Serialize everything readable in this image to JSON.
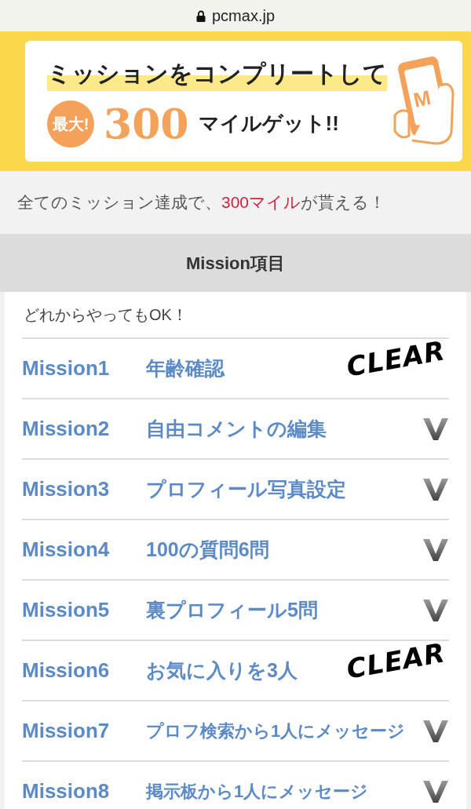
{
  "address_bar": {
    "url": "pcmax.jp"
  },
  "banner": {
    "headline": "ミッションをコンプリートして",
    "badge": "最大!",
    "amount": "300",
    "suffix": "マイルゲット!!",
    "phone_letter": "M"
  },
  "subtitle": {
    "before": "全てのミッション達成で、",
    "highlight": "300マイル",
    "after": "が貰える！"
  },
  "section": {
    "title": "Mission項目",
    "note": "どれからやってもOK！"
  },
  "missions": [
    {
      "label": "Mission1",
      "title": "年齢確認",
      "cleared": true,
      "stamp": "CLEAR"
    },
    {
      "label": "Mission2",
      "title": "自由コメントの編集",
      "cleared": false
    },
    {
      "label": "Mission3",
      "title": "プロフィール写真設定",
      "cleared": false
    },
    {
      "label": "Mission4",
      "title": "100の質問6問",
      "cleared": false
    },
    {
      "label": "Mission5",
      "title": "裏プロフィール5問",
      "cleared": false
    },
    {
      "label": "Mission6",
      "title": "お気に入りを3人",
      "cleared": true,
      "stamp": "CLEAR"
    },
    {
      "label": "Mission7",
      "title": "プロフ検索から1人にメッセージ",
      "cleared": false
    },
    {
      "label": "Mission8",
      "title": "掲示板から1人にメッセージ",
      "cleared": false
    }
  ]
}
